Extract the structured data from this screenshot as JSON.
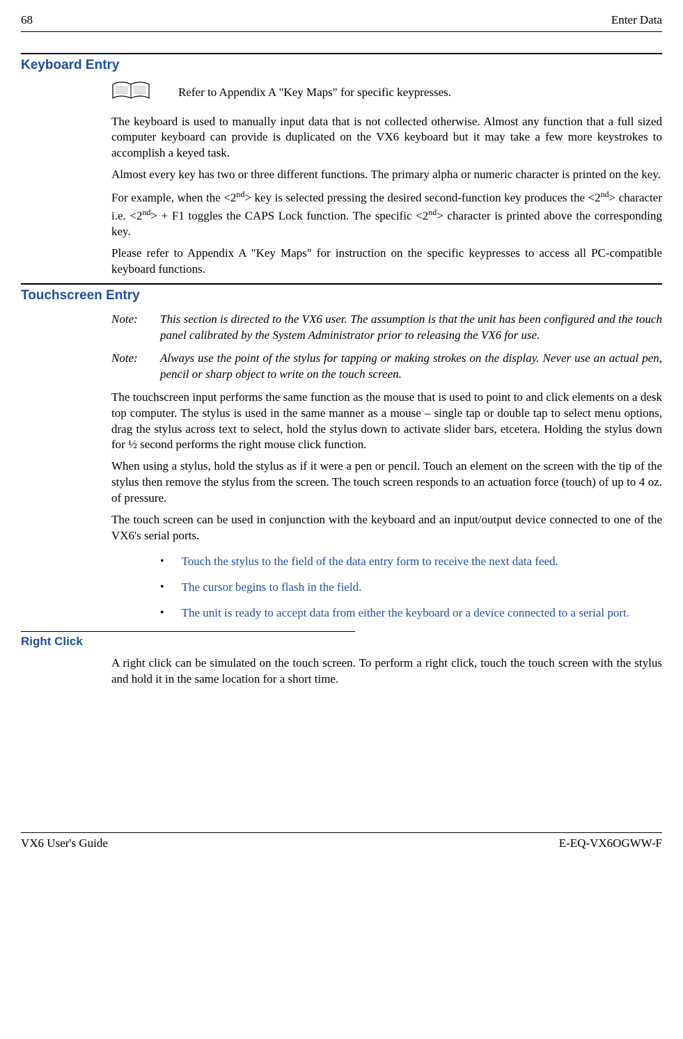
{
  "header": {
    "page": "68",
    "title": "Enter Data"
  },
  "section1": {
    "heading": "Keyboard Entry",
    "refer": "Refer to Appendix A \"Key Maps\" for specific keypresses.",
    "p1": "The keyboard is used to manually input data that is not collected otherwise. Almost any function that a full sized computer keyboard can provide is duplicated on the VX6 keyboard but it may take a few more keystrokes to accomplish a keyed task.",
    "p2": "Almost every key has two or three different functions. The primary alpha or numeric character is printed on the key.",
    "p3a": "For example, when the <2",
    "p3b": "> key is selected pressing the desired second-function key produces the <2",
    "p3c": "> character i.e. <2",
    "p3d": "> + F1 toggles the CAPS Lock function. The specific <2",
    "p3e": "> character is printed above the corresponding key.",
    "nd": "nd",
    "p4": "Please refer to Appendix A \"Key Maps\" for instruction on the specific keypresses to access all PC-compatible keyboard functions."
  },
  "section2": {
    "heading": "Touchscreen Entry",
    "note1label": "Note:",
    "note1": "This section is directed to the VX6 user. The assumption is that the unit has been configured and the touch panel calibrated by the System Administrator prior to releasing the VX6 for use.",
    "note2label": "Note:",
    "note2": "Always use the point of the stylus for tapping or making strokes on the display. Never use an actual pen, pencil or sharp object to write on the touch screen.",
    "p1": "The touchscreen input performs the same function as the mouse that is used to point to and click elements on a desk top computer. The stylus is used in the same manner as a mouse – single tap or double tap to select menu options, drag the stylus across text to select, hold the stylus down to activate slider bars, etcetera.  Holding the stylus down for ½ second performs the right mouse click function.",
    "p2": "When using a stylus, hold the stylus as if it were a pen or pencil. Touch an element on the screen with the tip of the stylus then remove the stylus from the screen. The touch screen responds to an actuation force (touch) of up to 4 oz. of pressure.",
    "p3": "The touch screen can be used in conjunction with the keyboard and an input/output device connected to one of the VX6's serial ports.",
    "bullets": [
      "Touch the stylus to the field of the data entry form to receive the next data feed.",
      "The cursor begins to flash in the field.",
      "The unit is ready to accept data from either the keyboard or a device connected to a serial port."
    ]
  },
  "section3": {
    "heading": "Right Click",
    "p1": "A right click can be simulated on the touch screen.  To perform a right click, touch the touch screen with the stylus and hold it in the same location for a short time."
  },
  "footer": {
    "left": "VX6 User's Guide",
    "right": "E-EQ-VX6OGWW-F"
  }
}
